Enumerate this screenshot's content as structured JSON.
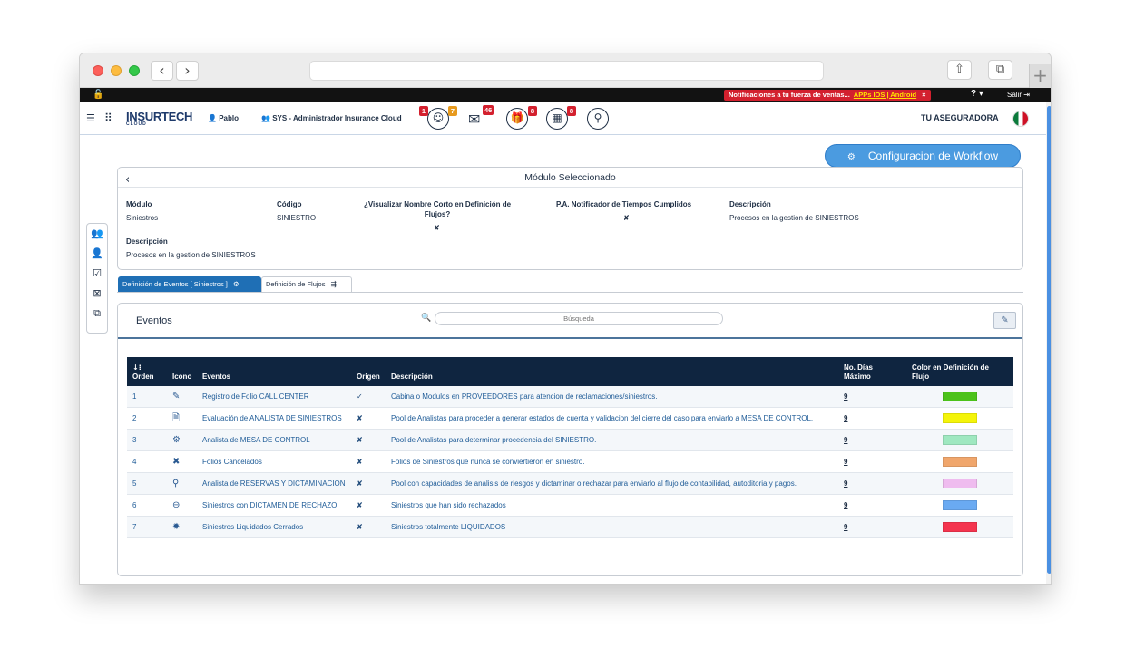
{
  "browser": {
    "back_icon": "‹",
    "forward_icon": "›",
    "share_icon": "⇧",
    "tabs_icon": "⧉",
    "new_tab_icon": "+"
  },
  "topbar": {
    "notification": "Notificaciones a tu fuerza de ventas...",
    "notification_link": "APPs IOS | Android",
    "close": "×",
    "help": "?",
    "logout": "Salir"
  },
  "header": {
    "logo": "INSURTECH",
    "logo_sub": "CLOUD",
    "user": "Pablo",
    "role": "SYS - Administrador Insurance Cloud",
    "badges": {
      "profile_red": "1",
      "profile_orange": "7",
      "mail": "46",
      "gift": "8",
      "calendar": "8"
    },
    "company": "TU ASEGURADORA"
  },
  "workflow_button": "Configuracion de Workflow",
  "module": {
    "title": "Módulo Seleccionado",
    "fields": {
      "modulo_label": "Módulo",
      "modulo_value": "Siniestros",
      "codigo_label": "Código",
      "codigo_value": "SINIESTRO",
      "visualizar_label_1": "¿Visualizar Nombre Corto en Definición de",
      "visualizar_label_2": "Flujos?",
      "visualizar_value": "✘",
      "pa_label": "P.A. Notificador de Tiempos Cumplidos",
      "pa_value": "✘",
      "descripcion_label": "Descripción",
      "descripcion_value": "Procesos en la gestion de SINIESTROS",
      "descripcion2_label": "Descripción",
      "descripcion2_value": "Procesos en la gestion de SINIESTROS"
    }
  },
  "tabs": [
    {
      "label": "Definición de Eventos [ Siniestros ]"
    },
    {
      "label": "Definición de Flujos"
    }
  ],
  "events": {
    "title": "Eventos",
    "search_placeholder": "Búsqueda",
    "columns": {
      "orden_icon": "↓⁝",
      "orden": "Orden",
      "icono": "Icono",
      "eventos": "Eventos",
      "origen": "Origen",
      "descripcion": "Descripción",
      "dias_1": "No. Días",
      "dias_2": "Máximo",
      "color_1": "Color en Definición de",
      "color_2": "Flujo"
    },
    "rows": [
      {
        "orden": "1",
        "icon": "✎",
        "evento": "Registro de Folio CALL CENTER",
        "origen": "✓",
        "descripcion": "Cabina o Modulos en PROVEEDORES para atencion de reclamaciones/siniestros.",
        "dias": "9",
        "color": "#4cc21a"
      },
      {
        "orden": "2",
        "icon": "🗎",
        "evento": "Evaluación de ANALISTA DE SINIESTROS",
        "origen": "✘",
        "descripcion": "Pool de Analistas para proceder a generar estados de cuenta y validacion del cierre del caso para enviarlo a MESA DE CONTROL.",
        "dias": "9",
        "color": "#f4f40a"
      },
      {
        "orden": "3",
        "icon": "⚙",
        "evento": "Analista de MESA DE CONTROL",
        "origen": "✘",
        "descripcion": "Pool de Analistas para determinar procedencia del SINIESTRO.",
        "dias": "9",
        "color": "#9fe8c0"
      },
      {
        "orden": "4",
        "icon": "✖",
        "evento": "Folios Cancelados",
        "origen": "✘",
        "descripcion": "Folios de Siniestros que nunca se conviertieron en siniestro.",
        "dias": "9",
        "color": "#f0a66c"
      },
      {
        "orden": "5",
        "icon": "⚲",
        "evento": "Analista de RESERVAS Y DICTAMINACION",
        "origen": "✘",
        "descripcion": "Pool con capacidades de analisis de riesgos y dictaminar o rechazar para enviarlo al flujo de contabilidad, autoditoria y pagos.",
        "dias": "9",
        "color": "#efbcef"
      },
      {
        "orden": "6",
        "icon": "⊖",
        "evento": "Siniestros con DICTAMEN DE RECHAZO",
        "origen": "✘",
        "descripcion": "Siniestros que han sido rechazados",
        "dias": "9",
        "color": "#6aaaf2"
      },
      {
        "orden": "7",
        "icon": "✹",
        "evento": "Siniestros Liquidados Cerrados",
        "origen": "✘",
        "descripcion": "Siniestros totalmente LIQUIDADOS",
        "dias": "9",
        "color": "#f4344e"
      }
    ]
  }
}
